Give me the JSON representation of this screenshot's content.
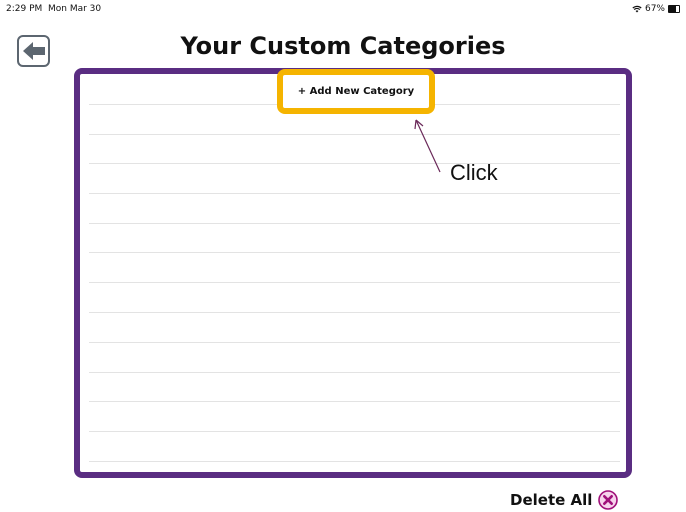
{
  "status_bar": {
    "time": "2:29 PM",
    "date": "Mon Mar 30",
    "battery": "67%",
    "battery_level": 0.67,
    "wifi_icon": "wifi-icon"
  },
  "header": {
    "title": "Your Custom Categories",
    "back_icon": "arrow-left-icon"
  },
  "categories_panel": {
    "add_button_label": "+ Add New Category",
    "border_color": "#5a2d82"
  },
  "annotation": {
    "label": "Click",
    "highlight_color": "#f5b400",
    "arrow_color": "#6b2a5a"
  },
  "footer": {
    "delete_label": "Delete All",
    "delete_icon": "close-circle-icon",
    "delete_color": "#a0107a"
  }
}
